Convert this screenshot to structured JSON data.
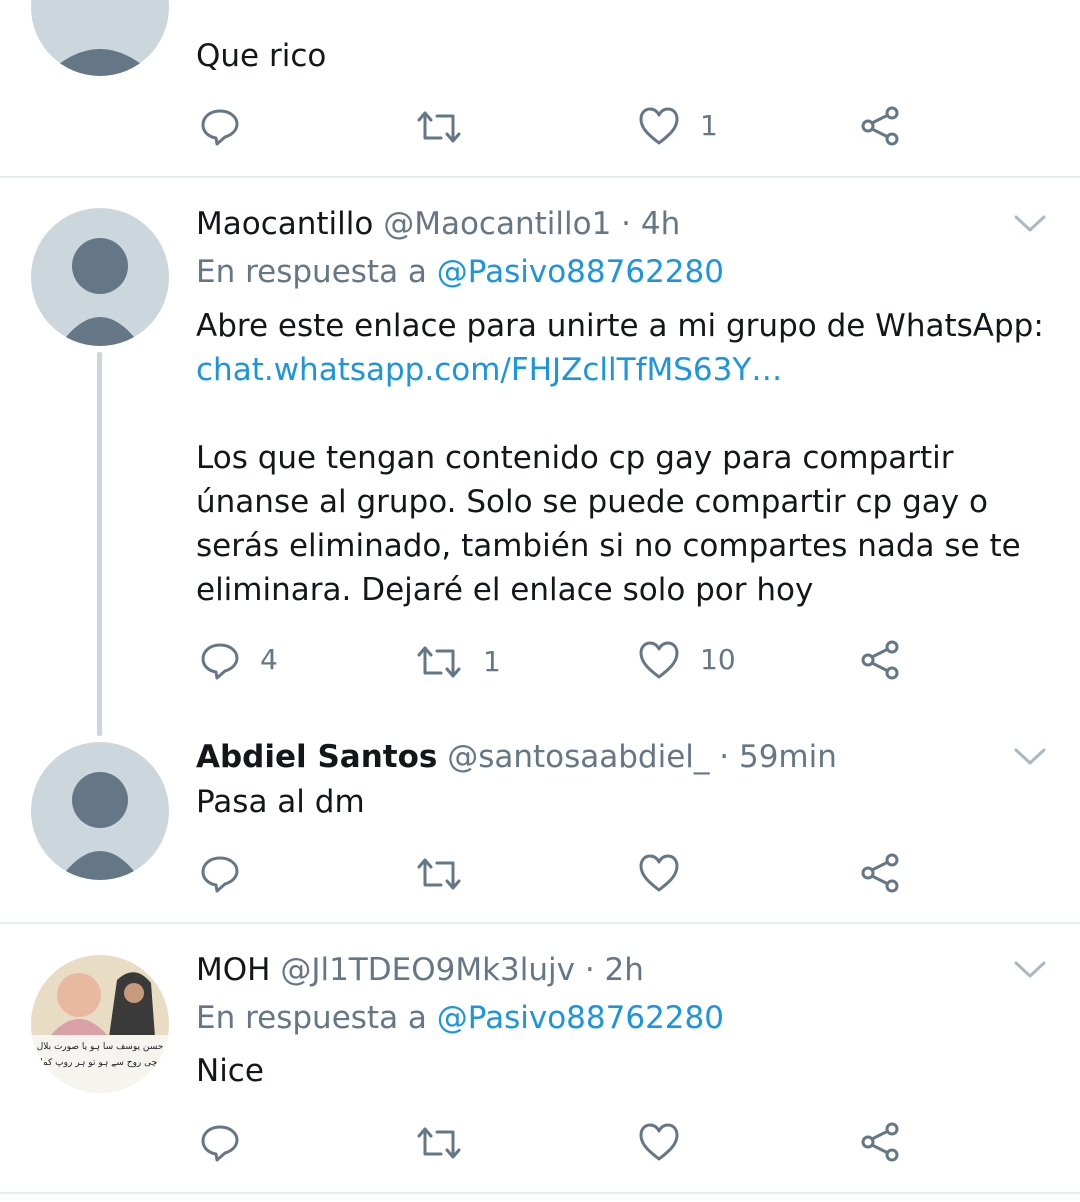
{
  "tweets": [
    {
      "text": "Que rico",
      "actions": {
        "reply_count": "",
        "retweet_count": "",
        "like_count": "1"
      }
    },
    {
      "name": "Maocantillo",
      "handle": "@Maocantillo1",
      "sep": "·",
      "time": "4h",
      "reply_prefix": "En respuesta a",
      "reply_to": "@Pasivo88762280",
      "text_line1": "Abre este enlace para unirte a mi grupo de WhatsApp:",
      "link": "chat.whatsapp.com/FHJZcllTfMS63Y…",
      "text_body": "Los que tengan contenido cp gay para compartir únanse al grupo. Solo se puede compartir cp gay o serás eliminado, también si no compartes nada se te eliminara. Dejaré el enlace solo por hoy",
      "actions": {
        "reply_count": "4",
        "retweet_count": "1",
        "like_count": "10"
      }
    },
    {
      "name": "Abdiel Santos",
      "handle": "@santosaabdiel_",
      "sep": "·",
      "time": "59min",
      "text": "Pasa al dm",
      "actions": {
        "reply_count": "",
        "retweet_count": "",
        "like_count": ""
      }
    },
    {
      "name": "MOH",
      "handle": "@Jl1TDEO9Mk3lujv",
      "sep": "·",
      "time": "2h",
      "reply_prefix": "En respuesta a",
      "reply_to": "@Pasivo88762280",
      "text": "Nice",
      "avatar_caption_line1": "حسن یوسف سا ہو یا صورت بلال",
      "avatar_caption_line2": "سچی روح سے ہو تو ہر روپ کمال",
      "actions": {
        "reply_count": "",
        "retweet_count": "",
        "like_count": ""
      }
    }
  ],
  "icons": {
    "reply": "reply-icon",
    "retweet": "retweet-icon",
    "like": "like-icon",
    "share": "share-icon",
    "caret": "chevron-down-icon"
  },
  "colors": {
    "icon_gray": "#657786",
    "link_blue": "#1b95e0",
    "avatar_gray": "#ccd6dd",
    "avatar_fg": "#657786",
    "divider": "#e6ecf0"
  }
}
